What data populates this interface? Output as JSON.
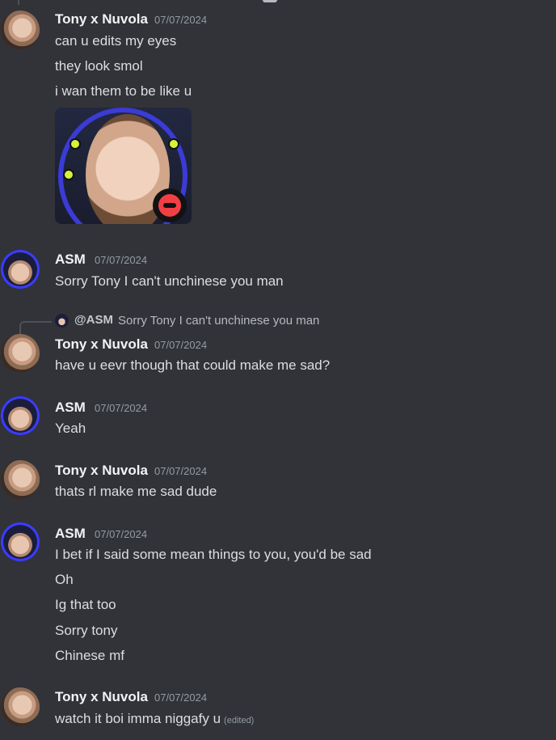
{
  "users": {
    "tony": "Tony x Nuvola",
    "asm": "ASM"
  },
  "date": "07/07/2024",
  "messages": [
    {
      "author": "Tony x Nuvola",
      "timestamp": "07/07/2024",
      "lines": [
        "can u edits my eyes",
        "they look smol",
        "i wan them to be like u"
      ]
    },
    {
      "author": "ASM",
      "timestamp": "07/07/2024",
      "lines": [
        "Sorry Tony I can't unchinese you man"
      ]
    },
    {
      "reply_to": {
        "mention": "@ASM",
        "text": "Sorry Tony I can't unchinese you man"
      },
      "author": "Tony x Nuvola",
      "timestamp": "07/07/2024",
      "lines": [
        "have u eevr though that could make me sad?"
      ]
    },
    {
      "author": "ASM",
      "timestamp": "07/07/2024",
      "lines": [
        "Yeah"
      ]
    },
    {
      "author": "Tony x Nuvola",
      "timestamp": "07/07/2024",
      "lines": [
        "thats rl make me sad dude"
      ]
    },
    {
      "author": "ASM",
      "timestamp": "07/07/2024",
      "lines": [
        "I bet if I said some mean things to you, you'd be sad",
        "Oh",
        "Ig that too",
        "Sorry tony",
        "Chinese mf"
      ]
    },
    {
      "author": "Tony x Nuvola",
      "timestamp": "07/07/2024",
      "lines": [
        "watch it boi imma niggafy u"
      ],
      "edited_label": "(edited)"
    }
  ]
}
